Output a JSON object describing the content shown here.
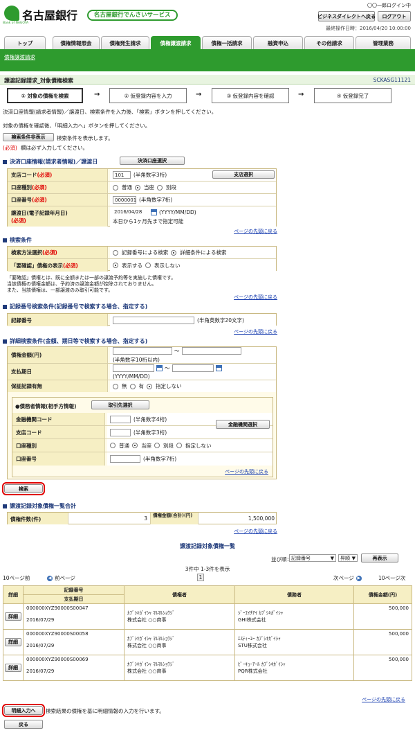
{
  "header": {
    "bank_name": "名古屋銀行",
    "bank_sub": "Bank of NAGOYA",
    "service_name": "名古屋銀行でんさいサービス",
    "user": "〇〇一郎ログイン中",
    "btn_direct": "ビジネスダイレクトへ戻る",
    "btn_logout": "ログアウト",
    "last_op": "最終操作日時：2016/04/20 10:00:00"
  },
  "tabs": [
    "トップ",
    "債権情報照会",
    "債権発生請求",
    "債権譲渡請求",
    "債権一括請求",
    "融資申込",
    "その他請求",
    "管理業務"
  ],
  "subnav": "債権譲渡請求",
  "title": {
    "text": "譲渡記録請求_対象債権検索",
    "code": "SCKASG11121"
  },
  "steps": [
    "① 対象の債権を検索",
    "② 仮登録内容を入力",
    "③ 仮登録内容を確認",
    "④ 仮登録完了"
  ],
  "intro": {
    "line1": "決済口座情報(請求者情報)／譲渡日、検索条件を入力後、「検索」ボタンを押してください。",
    "line2": "対象の債権を確認後、「明細入力へ」ボタンを押してください。",
    "toggle_btn": "検索条件非表示",
    "toggle_text": "検索条件を表示します。",
    "required_mark": "(必須)",
    "required_text": "欄は必ず入力してください。"
  },
  "common": {
    "required": "(必須)",
    "page_top": "ページの先頭に戻る"
  },
  "account": {
    "heading": "決済口座情報(請求者情報)／譲渡日",
    "select_btn": "決済口座選択",
    "branch_label": "支店コード",
    "branch_value": "101",
    "branch_hint": "(半角数字3桁)",
    "branch_btn": "支店選択",
    "type_label": "口座種別",
    "type_opts": [
      "普通",
      "当座",
      "別段"
    ],
    "number_label": "口座番号",
    "number_value": "0000001",
    "number_hint": "(半角数字7桁)",
    "date_label": "譲渡日(電子記録年月日)",
    "date_value": "2016/04/28",
    "date_hint": "(YYYY/MM/DD)",
    "date_note": "本日から1ヶ月先まで指定可能"
  },
  "search": {
    "heading": "検索条件",
    "method_label": "検索方法選択",
    "method_opts": [
      "記録番号による検索",
      "詳細条件による検索"
    ],
    "confirm_label": "「要確認」債権の表示",
    "confirm_opts": [
      "表示する",
      "表示しない"
    ],
    "note1": "「要確認」債権とは、既に全額または一部の譲渡予約等を実施した債権です。",
    "note2": "当該債権の債権金額は、予約済の譲渡金額が控除されておりません。",
    "note3": "また、当該債権は、一部譲渡のみ取引可能です。"
  },
  "record": {
    "heading": "記録番号検索条件(記録番号で検索する場合、指定する)",
    "label": "記録番号",
    "hint": "(半角英数字20文字)"
  },
  "detail": {
    "heading": "詳細検索条件(金額、期日等で検索する場合、指定する)",
    "amount_label": "債権金額(円)",
    "amount_hint": "(半角数字10桁以内)",
    "tilde": "～",
    "due_label": "支払期日",
    "due_hint": "(YYYY/MM/DD)",
    "guarantee_label": "保証記録有無",
    "guarantee_opts": [
      "無",
      "有",
      "指定しない"
    ],
    "debtor_heading": "●債務者情報(相手方情報)",
    "debtor_btn": "取引先選択",
    "bank_label": "金融機関コード",
    "bank_hint": "(半角数字4桁)",
    "bank_btn": "金融機関選択",
    "dbranch_label": "支店コード",
    "dbranch_hint": "(半角数字3桁)",
    "dtype_label": "口座種別",
    "dtype_opts": [
      "普通",
      "当座",
      "別段",
      "指定しない"
    ],
    "dnumber_label": "口座番号",
    "dnumber_hint": "(半角数字7桁)"
  },
  "search_btn": "検索",
  "total": {
    "heading": "譲渡記録対象債権一覧合計",
    "count_label": "債権件数(件)",
    "count_value": "3",
    "amount_label": "債権金額(合計)(円)",
    "amount_value": "1,500,000"
  },
  "list": {
    "title": "譲渡記録対象債権一覧",
    "sort_label": "並び順：",
    "sort_value": "記録番号",
    "order_value": "昇順",
    "resort_btn": "再表示",
    "count_text": "3件中 1-3件を表示",
    "prev10": "10ページ前",
    "prev": "前ページ",
    "page": "1",
    "next": "次ページ",
    "next10": "10ページ次",
    "headers": {
      "detail": "詳細",
      "record": "記録番号",
      "due": "支払期日",
      "creditor": "債権者",
      "debtor": "債務者",
      "amount": "債権金額(円)"
    },
    "detail_btn": "詳細",
    "rows": [
      {
        "record": "000000XYZ90000S00047",
        "due": "2016/07/29",
        "creditor_kana": "ｶﾌﾞｼｷｶﾞｲｼｬ ﾏﾙﾏﾙｼｮｳｼﾞ",
        "creditor": "株式会社 ○○商事",
        "debtor_kana": "ｼﾞｰｴｲﾁｱｲ ｶﾌﾞｼｷｶﾞｲｼｬ",
        "debtor": "GHI株式会社",
        "amount": "500,000"
      },
      {
        "record": "000000XYZ90000S00058",
        "due": "2016/07/29",
        "creditor_kana": "ｶﾌﾞｼｷｶﾞｲｼｬ ﾏﾙﾏﾙｼｮｳｼﾞ",
        "creditor": "株式会社 ○○商事",
        "debtor_kana": "ｴｽﾃｨｰﾕｰ ｶﾌﾞｼｷｶﾞｲｼｬ",
        "debtor": "STU株式会社",
        "amount": "500,000"
      },
      {
        "record": "000000XYZ90000S00069",
        "due": "2016/07/29",
        "creditor_kana": "ｶﾌﾞｼｷｶﾞｲｼｬ ﾏﾙﾏﾙｼｮｳｼﾞ",
        "creditor": "株式会社 ○○商事",
        "debtor_kana": "ﾋﾟｰｷｭｰｱｰﾙ ｶﾌﾞｼｷｶﾞｲｼｬ",
        "debtor": "PQR株式会社",
        "amount": "500,000"
      }
    ]
  },
  "footer": {
    "detail_input_btn": "明細入力へ",
    "detail_input_text": "検索結果の債権を基に明細情報の入力を行います。",
    "back_btn": "戻る"
  },
  "colors": {
    "green": "#2e9b2e",
    "navy": "#1f3a7a",
    "required": "#e00000"
  }
}
